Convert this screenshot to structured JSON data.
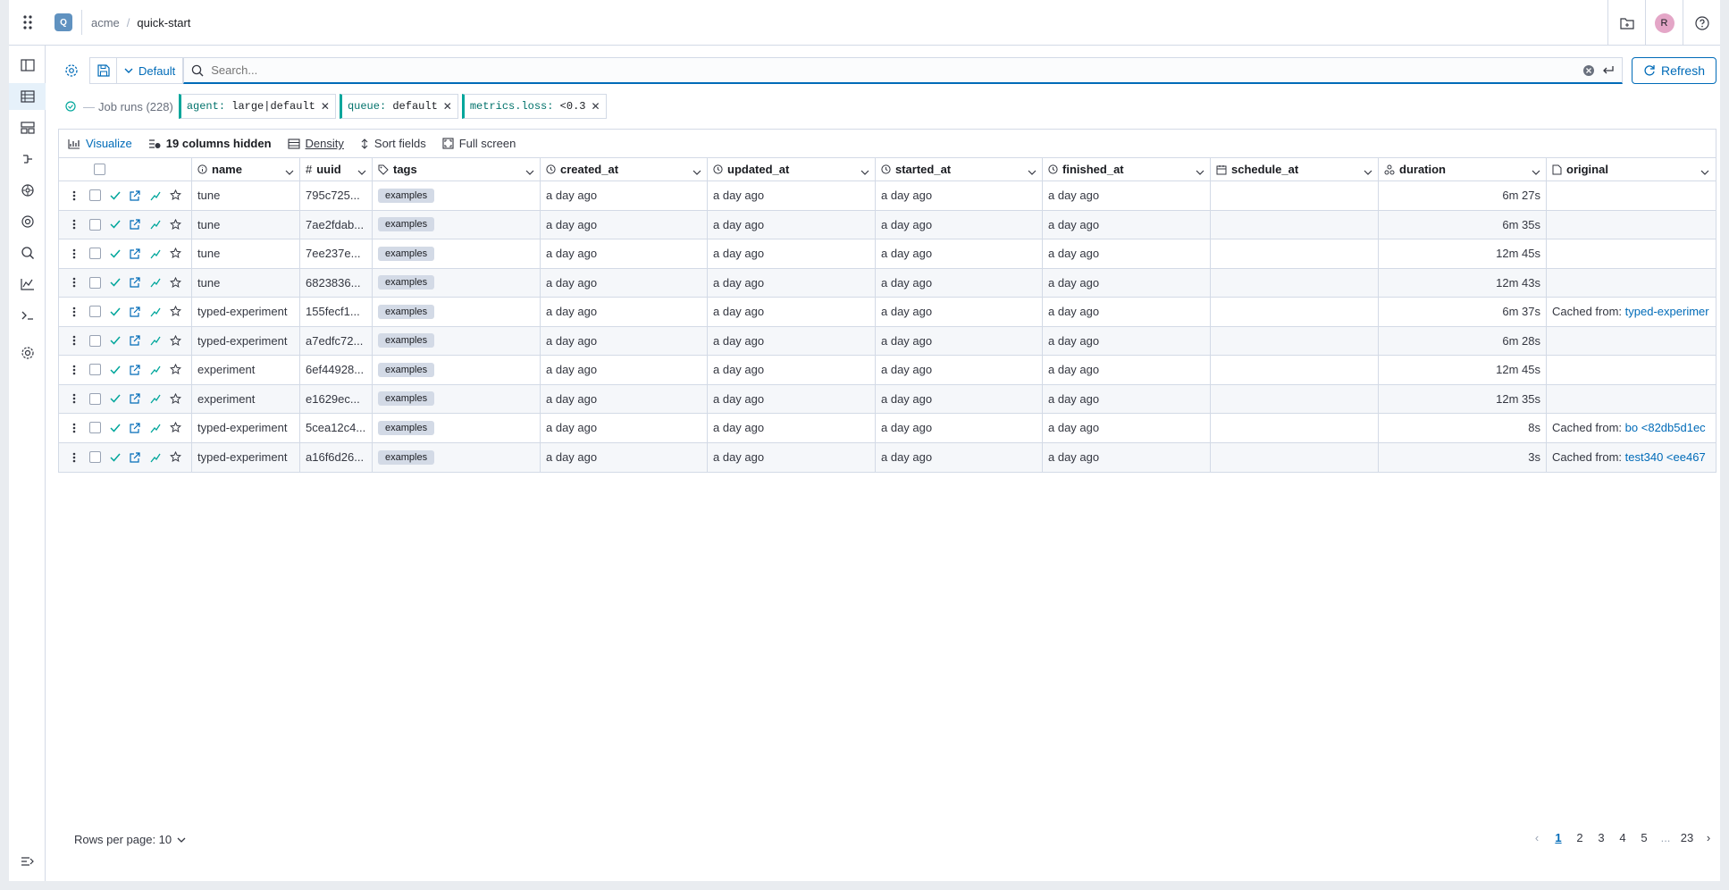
{
  "header": {
    "project_initial": "Q",
    "org": "acme",
    "separator": "/",
    "project": "quick-start",
    "user_initial": "R"
  },
  "search": {
    "view_label": "Default",
    "placeholder": "Search...",
    "refresh_label": "Refresh"
  },
  "filters": {
    "label": "Job runs (228)",
    "items": [
      {
        "key": "agent:",
        "value": "large|default"
      },
      {
        "key": "queue:",
        "value": "default"
      },
      {
        "key": "metrics.loss:",
        "value": "<0.3"
      }
    ]
  },
  "toolbar": {
    "visualize": "Visualize",
    "hidden": "19 columns hidden",
    "density": "Density",
    "sort": "Sort fields",
    "fullscreen": "Full screen"
  },
  "columns": [
    "name",
    "uuid",
    "tags",
    "created_at",
    "updated_at",
    "started_at",
    "finished_at",
    "schedule_at",
    "duration",
    "original"
  ],
  "rows": [
    {
      "name": "tune",
      "uuid": "795c725...",
      "tag": "examples",
      "created": "a day ago",
      "updated": "a day ago",
      "started": "a day ago",
      "finished": "a day ago",
      "schedule": "",
      "duration": "6m 27s",
      "orig_prefix": "",
      "orig_link": ""
    },
    {
      "name": "tune",
      "uuid": "7ae2fdab...",
      "tag": "examples",
      "created": "a day ago",
      "updated": "a day ago",
      "started": "a day ago",
      "finished": "a day ago",
      "schedule": "",
      "duration": "6m 35s",
      "orig_prefix": "",
      "orig_link": ""
    },
    {
      "name": "tune",
      "uuid": "7ee237e...",
      "tag": "examples",
      "created": "a day ago",
      "updated": "a day ago",
      "started": "a day ago",
      "finished": "a day ago",
      "schedule": "",
      "duration": "12m 45s",
      "orig_prefix": "",
      "orig_link": ""
    },
    {
      "name": "tune",
      "uuid": "6823836...",
      "tag": "examples",
      "created": "a day ago",
      "updated": "a day ago",
      "started": "a day ago",
      "finished": "a day ago",
      "schedule": "",
      "duration": "12m 43s",
      "orig_prefix": "",
      "orig_link": ""
    },
    {
      "name": "typed-experiment",
      "uuid": "155fecf1...",
      "tag": "examples",
      "created": "a day ago",
      "updated": "a day ago",
      "started": "a day ago",
      "finished": "a day ago",
      "schedule": "",
      "duration": "6m 37s",
      "orig_prefix": "Cached from:",
      "orig_link": "typed-experimer"
    },
    {
      "name": "typed-experiment",
      "uuid": "a7edfc72...",
      "tag": "examples",
      "created": "a day ago",
      "updated": "a day ago",
      "started": "a day ago",
      "finished": "a day ago",
      "schedule": "",
      "duration": "6m 28s",
      "orig_prefix": "",
      "orig_link": ""
    },
    {
      "name": "experiment",
      "uuid": "6ef44928...",
      "tag": "examples",
      "created": "a day ago",
      "updated": "a day ago",
      "started": "a day ago",
      "finished": "a day ago",
      "schedule": "",
      "duration": "12m 45s",
      "orig_prefix": "",
      "orig_link": ""
    },
    {
      "name": "experiment",
      "uuid": "e1629ec...",
      "tag": "examples",
      "created": "a day ago",
      "updated": "a day ago",
      "started": "a day ago",
      "finished": "a day ago",
      "schedule": "",
      "duration": "12m 35s",
      "orig_prefix": "",
      "orig_link": ""
    },
    {
      "name": "typed-experiment",
      "uuid": "5cea12c4...",
      "tag": "examples",
      "created": "a day ago",
      "updated": "a day ago",
      "started": "a day ago",
      "finished": "a day ago",
      "schedule": "",
      "duration": "8s",
      "orig_prefix": "Cached from:",
      "orig_link": "bo <82db5d1ec"
    },
    {
      "name": "typed-experiment",
      "uuid": "a16f6d26...",
      "tag": "examples",
      "created": "a day ago",
      "updated": "a day ago",
      "started": "a day ago",
      "finished": "a day ago",
      "schedule": "",
      "duration": "3s",
      "orig_prefix": "Cached from:",
      "orig_link": "test340 <ee467"
    }
  ],
  "pagination": {
    "rows_per_page": "Rows per page: 10",
    "pages": [
      "1",
      "2",
      "3",
      "4",
      "5"
    ],
    "ellipsis": "...",
    "last": "23"
  },
  "colors": {
    "accent": "#006bb8",
    "success": "#00a69b",
    "border": "#d3dae6"
  }
}
